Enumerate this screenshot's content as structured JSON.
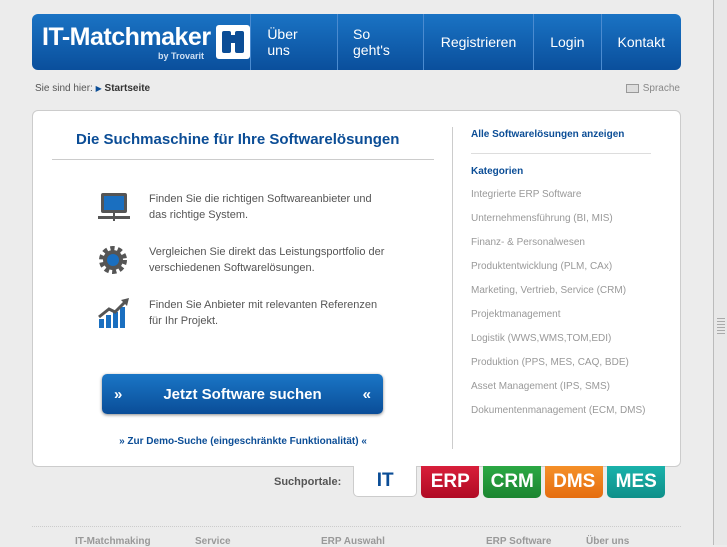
{
  "header": {
    "logo": "IT-Matchmaker",
    "logo_sub": "by Trovarit",
    "nav": [
      "Über uns",
      "So geht's",
      "Registrieren",
      "Login",
      "Kontakt"
    ]
  },
  "breadcrumb": {
    "label": "Sie sind hier:",
    "current": "Startseite"
  },
  "language": "Sprache",
  "main": {
    "title": "Die Suchmaschine für Ihre Softwarelösungen",
    "features": [
      "Finden Sie die richtigen Softwareanbieter und das richtige System.",
      "Vergleichen Sie direkt das Leistungsportfolio der verschiedenen Softwarelösungen.",
      "Finden Sie Anbieter mit relevanten Referenzen für Ihr Projekt."
    ],
    "search_button": "Jetzt Software suchen",
    "demo_link": "» Zur Demo-Suche (eingeschränkte Funktionalität) «"
  },
  "sidebar": {
    "all": "Alle Softwarelösungen anzeigen",
    "heading": "Kategorien",
    "items": [
      "Integrierte ERP Software",
      "Unternehmensführung (BI, MIS)",
      "Finanz- & Personalwesen",
      "Produktentwicklung (PLM, CAx)",
      "Marketing, Vertrieb, Service (CRM)",
      "Projektmanagement",
      "Logistik (WWS,WMS,TOM,EDI)",
      "Produktion (PPS, MES, CAQ, BDE)",
      "Asset Management (IPS, SMS)",
      "Dokumentenmanagement (ECM, DMS)"
    ]
  },
  "portals": {
    "label": "Suchportale:",
    "tabs": [
      {
        "label": "IT",
        "color": "#ffffff"
      },
      {
        "label": "ERP",
        "color": "#c8102e"
      },
      {
        "label": "CRM",
        "color": "#23973a"
      },
      {
        "label": "DMS",
        "color": "#f07d1c"
      },
      {
        "label": "MES",
        "color": "#13a09a"
      }
    ]
  },
  "footer": [
    "IT-Matchmaking",
    "Service",
    "ERP Auswahl",
    "ERP Software",
    "Über uns"
  ]
}
